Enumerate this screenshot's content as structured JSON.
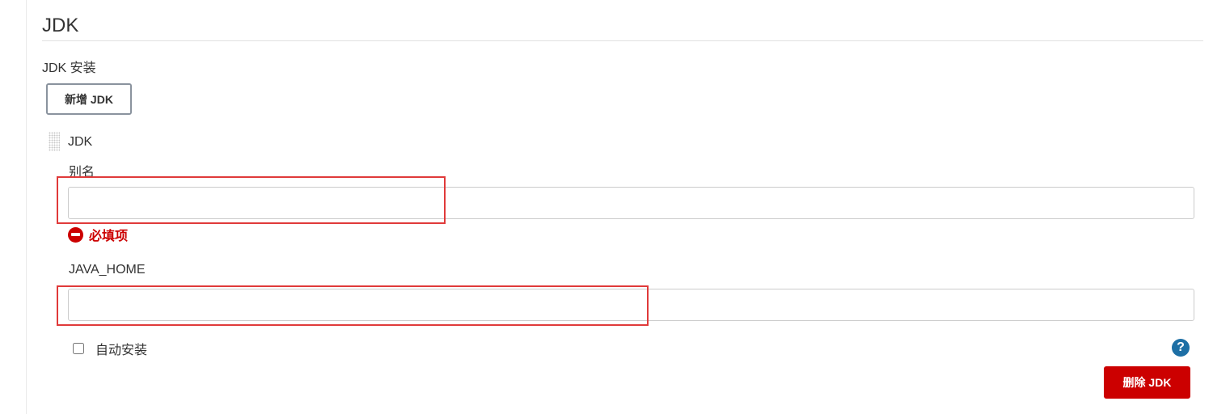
{
  "section": {
    "title": "JDK",
    "install_label": "JDK 安装",
    "add_button": "新增 JDK"
  },
  "jdk_item": {
    "label": "JDK",
    "alias_label": "别名",
    "alias_value": "",
    "required_error": "必填项",
    "home_label": "JAVA_HOME",
    "home_value": "",
    "auto_install_label": "自动安装",
    "auto_install_checked": false,
    "help_icon": "?",
    "delete_button": "删除 JDK"
  },
  "colors": {
    "error": "#cc0000",
    "highlight": "#e03a3a",
    "help": "#1d6fa5"
  }
}
